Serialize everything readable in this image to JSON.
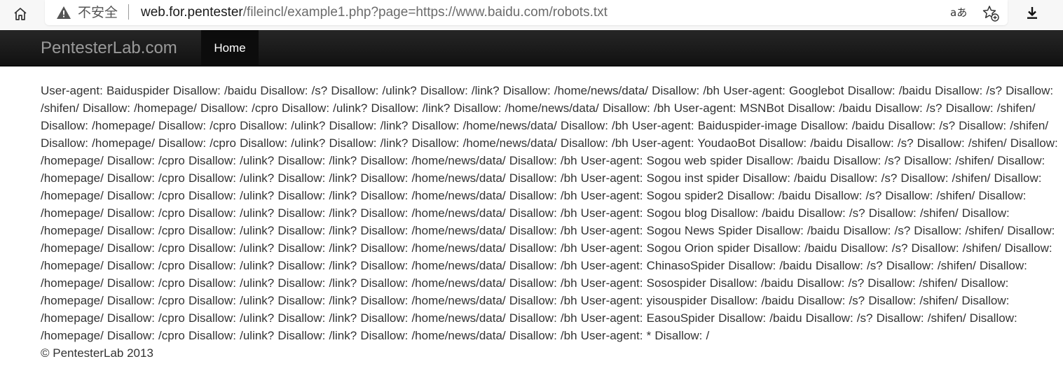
{
  "browser": {
    "security_label": "不安全",
    "url_host": "web.for.pentester",
    "url_path": "/fileincl/example1.php?page=https://www.baidu.com/robots.txt",
    "read_aloud_glyph": "aあ"
  },
  "navbar": {
    "brand": "PentesterLab.com",
    "home_label": "Home",
    "bg_color": "#1b1b1b"
  },
  "content": {
    "robots_text": "User-agent: Baiduspider Disallow: /baidu Disallow: /s? Disallow: /ulink? Disallow: /link? Disallow: /home/news/data/ Disallow: /bh User-agent: Googlebot Disallow: /baidu Disallow: /s? Disallow: /shifen/ Disallow: /homepage/ Disallow: /cpro Disallow: /ulink? Disallow: /link? Disallow: /home/news/data/ Disallow: /bh User-agent: MSNBot Disallow: /baidu Disallow: /s? Disallow: /shifen/ Disallow: /homepage/ Disallow: /cpro Disallow: /ulink? Disallow: /link? Disallow: /home/news/data/ Disallow: /bh User-agent: Baiduspider-image Disallow: /baidu Disallow: /s? Disallow: /shifen/ Disallow: /homepage/ Disallow: /cpro Disallow: /ulink? Disallow: /link? Disallow: /home/news/data/ Disallow: /bh User-agent: YoudaoBot Disallow: /baidu Disallow: /s? Disallow: /shifen/ Disallow: /homepage/ Disallow: /cpro Disallow: /ulink? Disallow: /link? Disallow: /home/news/data/ Disallow: /bh User-agent: Sogou web spider Disallow: /baidu Disallow: /s? Disallow: /shifen/ Disallow: /homepage/ Disallow: /cpro Disallow: /ulink? Disallow: /link? Disallow: /home/news/data/ Disallow: /bh User-agent: Sogou inst spider Disallow: /baidu Disallow: /s? Disallow: /shifen/ Disallow: /homepage/ Disallow: /cpro Disallow: /ulink? Disallow: /link? Disallow: /home/news/data/ Disallow: /bh User-agent: Sogou spider2 Disallow: /baidu Disallow: /s? Disallow: /shifen/ Disallow: /homepage/ Disallow: /cpro Disallow: /ulink? Disallow: /link? Disallow: /home/news/data/ Disallow: /bh User-agent: Sogou blog Disallow: /baidu Disallow: /s? Disallow: /shifen/ Disallow: /homepage/ Disallow: /cpro Disallow: /ulink? Disallow: /link? Disallow: /home/news/data/ Disallow: /bh User-agent: Sogou News Spider Disallow: /baidu Disallow: /s? Disallow: /shifen/ Disallow: /homepage/ Disallow: /cpro Disallow: /ulink? Disallow: /link? Disallow: /home/news/data/ Disallow: /bh User-agent: Sogou Orion spider Disallow: /baidu Disallow: /s? Disallow: /shifen/ Disallow: /homepage/ Disallow: /cpro Disallow: /ulink? Disallow: /link? Disallow: /home/news/data/ Disallow: /bh User-agent: ChinasoSpider Disallow: /baidu Disallow: /s? Disallow: /shifen/ Disallow: /homepage/ Disallow: /cpro Disallow: /ulink? Disallow: /link? Disallow: /home/news/data/ Disallow: /bh User-agent: Sosospider Disallow: /baidu Disallow: /s? Disallow: /shifen/ Disallow: /homepage/ Disallow: /cpro Disallow: /ulink? Disallow: /link? Disallow: /home/news/data/ Disallow: /bh User-agent: yisouspider Disallow: /baidu Disallow: /s? Disallow: /shifen/ Disallow: /homepage/ Disallow: /cpro Disallow: /ulink? Disallow: /link? Disallow: /home/news/data/ Disallow: /bh User-agent: EasouSpider Disallow: /baidu Disallow: /s? Disallow: /shifen/ Disallow: /homepage/ Disallow: /cpro Disallow: /ulink? Disallow: /link? Disallow: /home/news/data/ Disallow: /bh User-agent: * Disallow: /",
    "footer": "© PentesterLab 2013"
  }
}
